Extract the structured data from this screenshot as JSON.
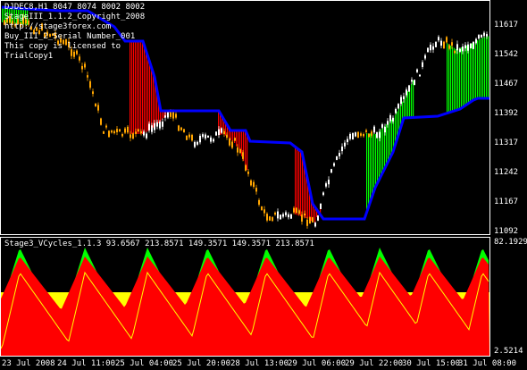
{
  "main_chart": {
    "header_lines": [
      "DJDEC8,H1  8047 8074 8002 8002",
      "StageIII_1.1.2_Copyright_2008",
      "http://stage3forex.com",
      "Buy_III_2_Serial Number_001",
      "This copy is licensed to",
      "TrialCopy1"
    ],
    "price_ticks": [
      "11617",
      "11542",
      "11467",
      "11392",
      "11317",
      "11242",
      "11167",
      "11092"
    ]
  },
  "indicator": {
    "title": "Stage3_VCycles_1.1.3 93.6567 213.8571 149.3571 149.3571 213.8571",
    "top_value": "82.1929",
    "bottom_value": "2.5214"
  },
  "time_axis": [
    "23 Jul 2008",
    "24 Jul 11:00",
    "25 Jul 04:00",
    "25 Jul 20:00",
    "28 Jul 13:00",
    "29 Jul 06:00",
    "29 Jul 22:00",
    "30 Jul 15:00",
    "31 Jul 08:00"
  ],
  "colors": {
    "background": "#000000",
    "blue_line": "#0000ff",
    "red_fill": "#ff0000",
    "green_fill": "#00ff00",
    "yellow_fill": "#ffff00",
    "candle_orange": "#ffa500",
    "candle_white": "#ffffff"
  }
}
